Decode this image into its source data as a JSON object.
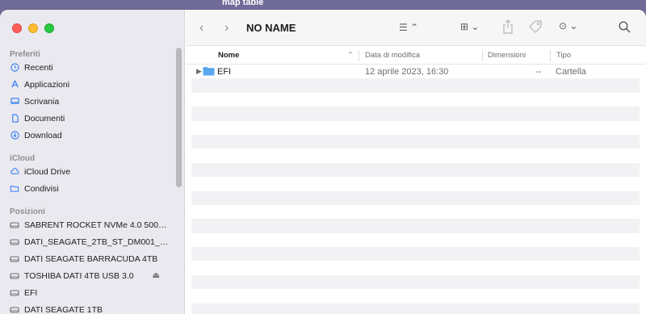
{
  "desktop": {
    "label": "map table"
  },
  "window": {
    "title": "NO NAME"
  },
  "sidebar": {
    "sections": [
      {
        "title": "Preferiti",
        "items": [
          {
            "label": "Recenti",
            "icon": "clock-icon"
          },
          {
            "label": "Applicazioni",
            "icon": "apps-icon"
          },
          {
            "label": "Scrivania",
            "icon": "desktop-icon"
          },
          {
            "label": "Documenti",
            "icon": "document-icon"
          },
          {
            "label": "Download",
            "icon": "download-icon"
          }
        ]
      },
      {
        "title": "iCloud",
        "items": [
          {
            "label": "iCloud Drive",
            "icon": "cloud-icon"
          },
          {
            "label": "Condivisi",
            "icon": "shared-folder-icon"
          }
        ]
      },
      {
        "title": "Posizioni",
        "items": [
          {
            "label": "SABRENT ROCKET NVMe 4.0 500GB",
            "icon": "drive-icon"
          },
          {
            "label": "DATI_SEAGATE_2TB_ST_DM001_1...",
            "icon": "drive-icon"
          },
          {
            "label": "DATI SEAGATE BARRACUDA 4TB",
            "icon": "drive-icon"
          },
          {
            "label": "TOSHIBA DATI 4TB USB 3.0",
            "icon": "drive-icon",
            "eject": "⏏"
          },
          {
            "label": "EFI",
            "icon": "drive-icon"
          },
          {
            "label": "DATI SEAGATE 1TB",
            "icon": "drive-icon"
          }
        ]
      }
    ]
  },
  "toolbar": {
    "back": "‹",
    "forward": "›",
    "list_view": "☰ ⌃",
    "grid_view": "⊞ ⌄",
    "share": "share-icon",
    "tag": "tag-icon",
    "more": "⊙ ⌄",
    "search": "search-icon"
  },
  "columns": {
    "name": "Nome",
    "date": "Data di modifica",
    "size": "Dimensioni",
    "type": "Tipo"
  },
  "files": [
    {
      "name": "EFI",
      "date": "12 aprile 2023, 16:30",
      "size": "--",
      "type": "Cartella"
    }
  ],
  "colors": {
    "accent": "#2f7bf6",
    "sidebar_bg": "#ebe9f0",
    "folder": "#5aa9f0"
  }
}
